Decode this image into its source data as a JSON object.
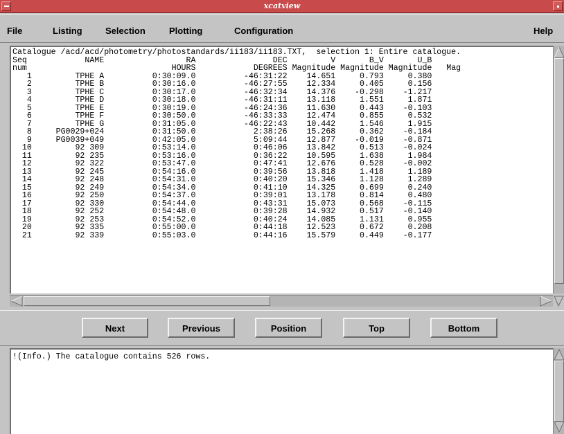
{
  "window": {
    "title": "xcatview"
  },
  "menu": {
    "file": "File",
    "listing": "Listing",
    "selection": "Selection",
    "plotting": "Plotting",
    "configuration": "Configuration",
    "help": "Help"
  },
  "catalogue": {
    "header_line": "Catalogue /acd/acd/photometry/photostandards/ii183/ii183.TXT,  selection 1: Entire catalogue.",
    "columns": [
      {
        "name1": "Seq",
        "name2": "num"
      },
      {
        "name1": "NAME",
        "name2": ""
      },
      {
        "name1": "RA",
        "name2": "HOURS"
      },
      {
        "name1": "DEC",
        "name2": "DEGREES"
      },
      {
        "name1": "V",
        "name2": "Magnitude"
      },
      {
        "name1": "B_V",
        "name2": "Magnitude"
      },
      {
        "name1": "U_B",
        "name2": "Magnitude"
      },
      {
        "name1": "",
        "name2": "Mag"
      }
    ],
    "rows": [
      [
        "1",
        "TPHE A",
        "0:30:09.0",
        "-46:31:22",
        "14.651",
        "0.793",
        "0.380"
      ],
      [
        "2",
        "TPHE B",
        "0:30:16.0",
        "-46:27:55",
        "12.334",
        "0.405",
        "0.156"
      ],
      [
        "3",
        "TPHE C",
        "0:30:17.0",
        "-46:32:34",
        "14.376",
        "-0.298",
        "-1.217"
      ],
      [
        "4",
        "TPHE D",
        "0:30:18.0",
        "-46:31:11",
        "13.118",
        "1.551",
        "1.871"
      ],
      [
        "5",
        "TPHE E",
        "0:30:19.0",
        "-46:24:36",
        "11.630",
        "0.443",
        "-0.103"
      ],
      [
        "6",
        "TPHE F",
        "0:30:50.0",
        "-46:33:33",
        "12.474",
        "0.855",
        "0.532"
      ],
      [
        "7",
        "TPHE G",
        "0:31:05.0",
        "-46:22:43",
        "10.442",
        "1.546",
        "1.915"
      ],
      [
        "8",
        "PG0029+024",
        "0:31:50.0",
        "2:38:26",
        "15.268",
        "0.362",
        "-0.184"
      ],
      [
        "9",
        "PG0039+049",
        "0:42:05.0",
        "5:09:44",
        "12.877",
        "-0.019",
        "-0.871"
      ],
      [
        "10",
        "92 309",
        "0:53:14.0",
        "0:46:06",
        "13.842",
        "0.513",
        "-0.024"
      ],
      [
        "11",
        "92 235",
        "0:53:16.0",
        "0:36:22",
        "10.595",
        "1.638",
        "1.984"
      ],
      [
        "12",
        "92 322",
        "0:53:47.0",
        "0:47:41",
        "12.676",
        "0.528",
        "-0.002"
      ],
      [
        "13",
        "92 245",
        "0:54:16.0",
        "0:39:56",
        "13.818",
        "1.418",
        "1.189"
      ],
      [
        "14",
        "92 248",
        "0:54:31.0",
        "0:40:20",
        "15.346",
        "1.128",
        "1.289"
      ],
      [
        "15",
        "92 249",
        "0:54:34.0",
        "0:41:10",
        "14.325",
        "0.699",
        "0.240"
      ],
      [
        "16",
        "92 250",
        "0:54:37.0",
        "0:39:01",
        "13.178",
        "0.814",
        "0.480"
      ],
      [
        "17",
        "92 330",
        "0:54:44.0",
        "0:43:31",
        "15.073",
        "0.568",
        "-0.115"
      ],
      [
        "18",
        "92 252",
        "0:54:48.0",
        "0:39:28",
        "14.932",
        "0.517",
        "-0.140"
      ],
      [
        "19",
        "92 253",
        "0:54:52.0",
        "0:40:24",
        "14.085",
        "1.131",
        "0.955"
      ],
      [
        "20",
        "92 335",
        "0:55:00.0",
        "0:44:18",
        "12.523",
        "0.672",
        "0.208"
      ],
      [
        "21",
        "92 339",
        "0:55:03.0",
        "0:44:16",
        "15.579",
        "0.449",
        "-0.177"
      ]
    ]
  },
  "buttons": {
    "next": "Next",
    "previous": "Previous",
    "position": "Position",
    "top": "Top",
    "bottom": "Bottom"
  },
  "info": {
    "message": "!(Info.) The catalogue contains 526 rows."
  }
}
